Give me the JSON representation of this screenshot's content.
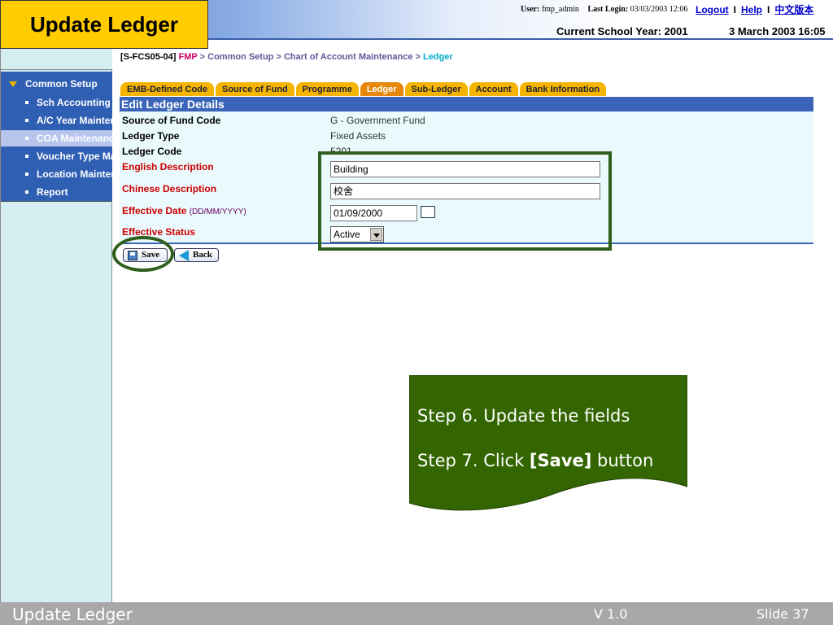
{
  "slide_title": "Update Ledger",
  "header": {
    "user_label": "User:",
    "user_value": "fmp_admin",
    "last_login_label": "Last Login:",
    "last_login_value": "03/03/2003 12:06",
    "logout": "Logout",
    "help": "Help",
    "chinese": "中文版本",
    "separator": "I",
    "school_year": "Current School Year: 2001",
    "datetime": "3 March 2003 16:05"
  },
  "sidebar": {
    "section": "Common Setup",
    "items": [
      {
        "label": "Sch Accounting P",
        "active": false
      },
      {
        "label": "A/C Year Maintena",
        "active": false
      },
      {
        "label": "COA Maintenance",
        "active": true
      },
      {
        "label": "Voucher Type Mai",
        "active": false
      },
      {
        "label": "Location Mainten",
        "active": false
      },
      {
        "label": "Report",
        "active": false
      }
    ]
  },
  "breadcrumb": {
    "code": "[S-FCS05-04]",
    "fmp": "FMP",
    "sep": ">",
    "common_setup": "Common Setup",
    "coa": "Chart of Account Maintenance",
    "current": "Ledger"
  },
  "tabs": [
    {
      "label": "EMB-Defined Code",
      "active": false
    },
    {
      "label": "Source of Fund",
      "active": false
    },
    {
      "label": "Programme",
      "active": false
    },
    {
      "label": "Ledger",
      "active": true
    },
    {
      "label": "Sub-Ledger",
      "active": false
    },
    {
      "label": "Account",
      "active": false
    },
    {
      "label": "Bank Information",
      "active": false
    }
  ],
  "form": {
    "title": "Edit Ledger Details",
    "source_fund_label": "Source of Fund Code",
    "source_fund_value": "G - Government Fund",
    "ledger_type_label": "Ledger Type",
    "ledger_type_value": "Fixed Assets",
    "ledger_code_label": "Ledger Code",
    "ledger_code_value": "5201",
    "english_desc_label": "English Description",
    "english_desc_value": "Building",
    "chinese_desc_label": "Chinese Description",
    "chinese_desc_value": "校舍",
    "effective_date_label": "Effective Date",
    "effective_date_hint": "(DD/MM/YYYY)",
    "effective_date_value": "01/09/2000",
    "effective_status_label": "Effective Status",
    "effective_status_value": "Active",
    "save_label": "Save",
    "back_label": "Back"
  },
  "callout": {
    "step6": "Step 6. Update the fields",
    "step7_prefix": "Step 7. Click ",
    "step7_bold": "[Save]",
    "step7_suffix": " button",
    "color": "#336600"
  },
  "footer": {
    "title": "Update Ledger",
    "version": "V 1.0",
    "slide": "Slide 37"
  },
  "colors": {
    "title_bg": "#ffcc00",
    "sidebar_menu": "#2f5fb3",
    "tab": "#f5b400",
    "tab_active": "#e8880a",
    "panel_head": "#3a64b8",
    "highlight": "#2e5f1c"
  }
}
